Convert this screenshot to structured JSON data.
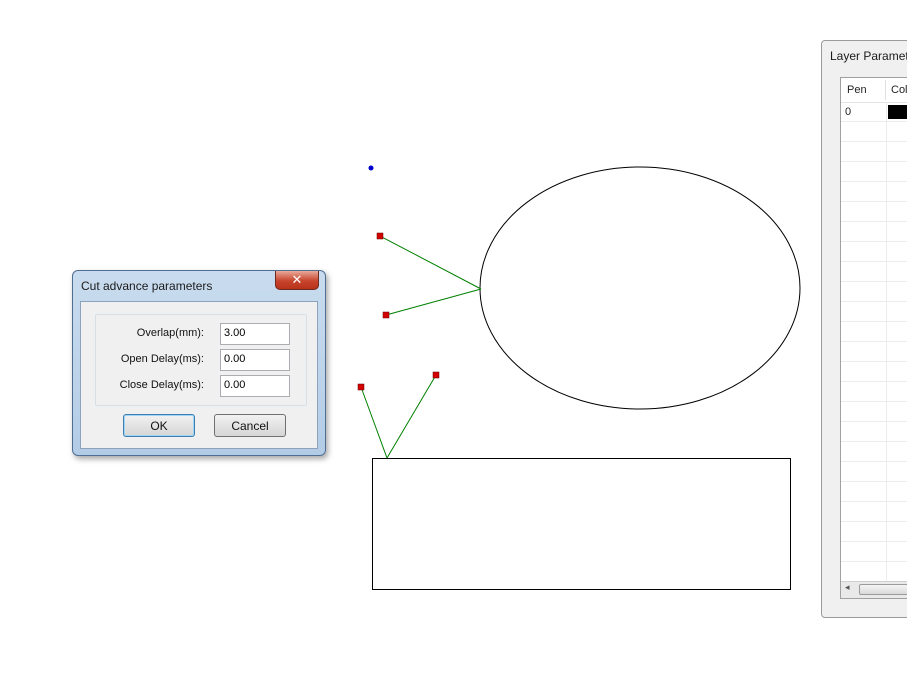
{
  "dialog": {
    "title": "Cut advance parameters",
    "close_glyph": "✕",
    "fields": [
      {
        "label": "Overlap(mm):",
        "value": "3.00"
      },
      {
        "label": "Open Delay(ms):",
        "value": "0.00"
      },
      {
        "label": "Close Delay(ms):",
        "value": "0.00"
      }
    ],
    "ok_label": "OK",
    "cancel_label": "Cancel"
  },
  "layer_panel": {
    "title": "Layer Parameter",
    "columns": [
      "Pen",
      "Color"
    ],
    "rows": [
      {
        "pen": "0",
        "color": "#000000"
      }
    ]
  },
  "canvas": {
    "shape_stroke": "#000000",
    "lead_line_color": "#008000",
    "handle_color": "#d40000",
    "origin_marker_color": "#0000cc"
  }
}
